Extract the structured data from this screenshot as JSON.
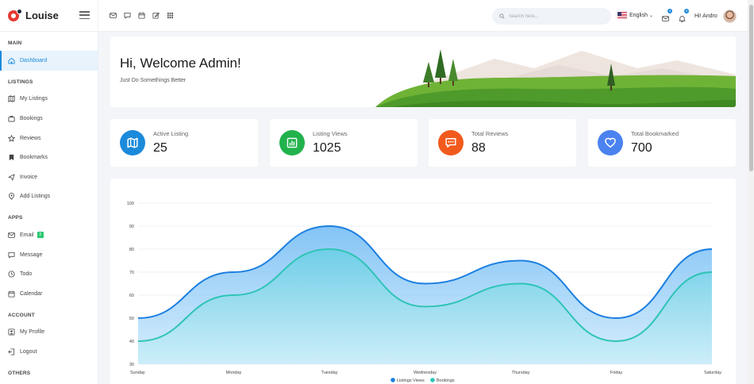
{
  "brand": {
    "name": "Louise"
  },
  "sidebar": {
    "sections": [
      {
        "title": "MAIN",
        "items": [
          {
            "label": "Dashboard",
            "icon": "home-icon",
            "active": true
          }
        ]
      },
      {
        "title": "LISTINGS",
        "items": [
          {
            "label": "My Listings",
            "icon": "map-icon"
          },
          {
            "label": "Bookings",
            "icon": "briefcase-icon"
          },
          {
            "label": "Reviews",
            "icon": "star-icon"
          },
          {
            "label": "Bookmarks",
            "icon": "bookmark-icon"
          },
          {
            "label": "Invoice",
            "icon": "send-icon"
          },
          {
            "label": "Add Listings",
            "icon": "map-pin-icon"
          }
        ]
      },
      {
        "title": "APPS",
        "items": [
          {
            "label": "Email",
            "icon": "mail-icon",
            "badge": "3"
          },
          {
            "label": "Message",
            "icon": "message-icon"
          },
          {
            "label": "Todo",
            "icon": "clock-icon"
          },
          {
            "label": "Calendar",
            "icon": "calendar-icon"
          }
        ]
      },
      {
        "title": "ACCOUNT",
        "items": [
          {
            "label": "My Profile",
            "icon": "user-square-icon"
          },
          {
            "label": "Logout",
            "icon": "logout-icon"
          }
        ]
      },
      {
        "title": "OTHERS",
        "items": []
      }
    ]
  },
  "topbar": {
    "search_placeholder": "Search here...",
    "language": "English",
    "mail_count": "4",
    "bell_count": "5",
    "user_greeting": "Hi! Andro"
  },
  "welcome": {
    "title": "Hi, Welcome Admin!",
    "subtitle": "Just Do Somethings Better"
  },
  "stats": [
    {
      "label": "Active Listing",
      "value": "25",
      "color": "#1b8adb",
      "icon": "map-icon"
    },
    {
      "label": "Listing Views",
      "value": "1025",
      "color": "#22b24c",
      "icon": "bar-chart-icon"
    },
    {
      "label": "Total Reviews",
      "value": "88",
      "color": "#f25a1d",
      "icon": "chat-icon"
    },
    {
      "label": "Total Bookmarked",
      "value": "700",
      "color": "#4a82f0",
      "icon": "heart-icon"
    }
  ],
  "chart_data": {
    "type": "area",
    "categories": [
      "Sunday",
      "Monday",
      "Tuesday",
      "Wednesday",
      "Thursday",
      "Friday",
      "Saturday"
    ],
    "ylim": [
      30,
      100
    ],
    "yticks": [
      30,
      40,
      50,
      60,
      70,
      80,
      90,
      100
    ],
    "series": [
      {
        "name": "Listings Views",
        "values": [
          50,
          70,
          90,
          65,
          75,
          50,
          80
        ],
        "color": "#1b7fe0"
      },
      {
        "name": "Bookings",
        "values": [
          40,
          60,
          80,
          55,
          65,
          40,
          70
        ],
        "color": "#2ec4b6"
      }
    ],
    "grid": true,
    "legend": "bottom"
  }
}
